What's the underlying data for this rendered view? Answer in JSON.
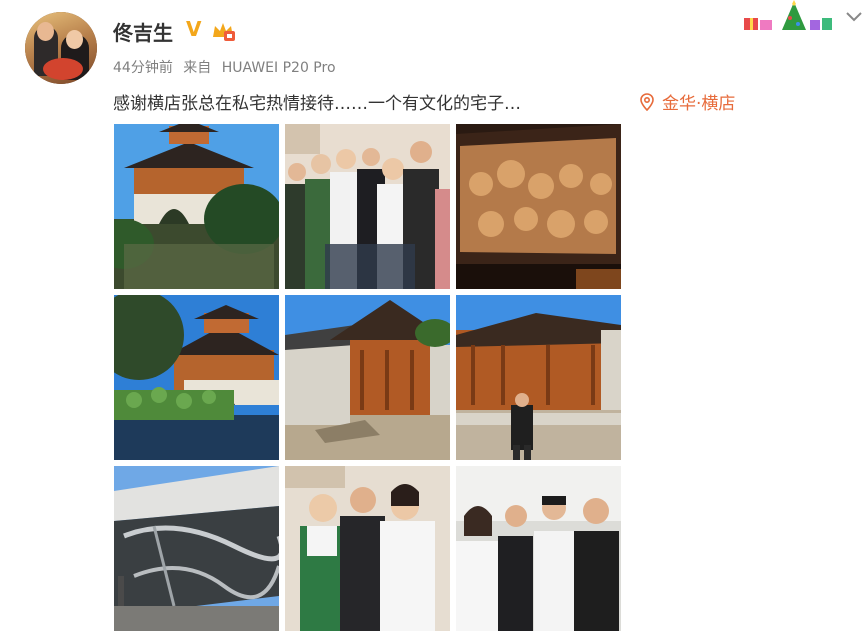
{
  "post": {
    "author": "佟吉生",
    "verified_badge": "V",
    "rank_icon": "level-crown-icon",
    "time": "44分钟前",
    "source_prefix": "来自",
    "source_device": "HUAWEI P20 Pro",
    "text": "感谢横店张总在私宅热情接待……一个有文化的宅子…",
    "location": "金华·横店",
    "colors": {
      "name": "#333333",
      "meta": "#808080",
      "location": "#e76b3b",
      "badge": "#f3a71b"
    }
  },
  "photos": [
    {
      "label": "photo-pavilion-garden"
    },
    {
      "label": "photo-group-indoor"
    },
    {
      "label": "photo-wood-carving"
    },
    {
      "label": "photo-lotus-pond-pavilion"
    },
    {
      "label": "photo-courtyard-hall"
    },
    {
      "label": "photo-hall-man-standing"
    },
    {
      "label": "photo-stone-wall"
    },
    {
      "label": "photo-three-people"
    },
    {
      "label": "photo-four-people"
    }
  ]
}
